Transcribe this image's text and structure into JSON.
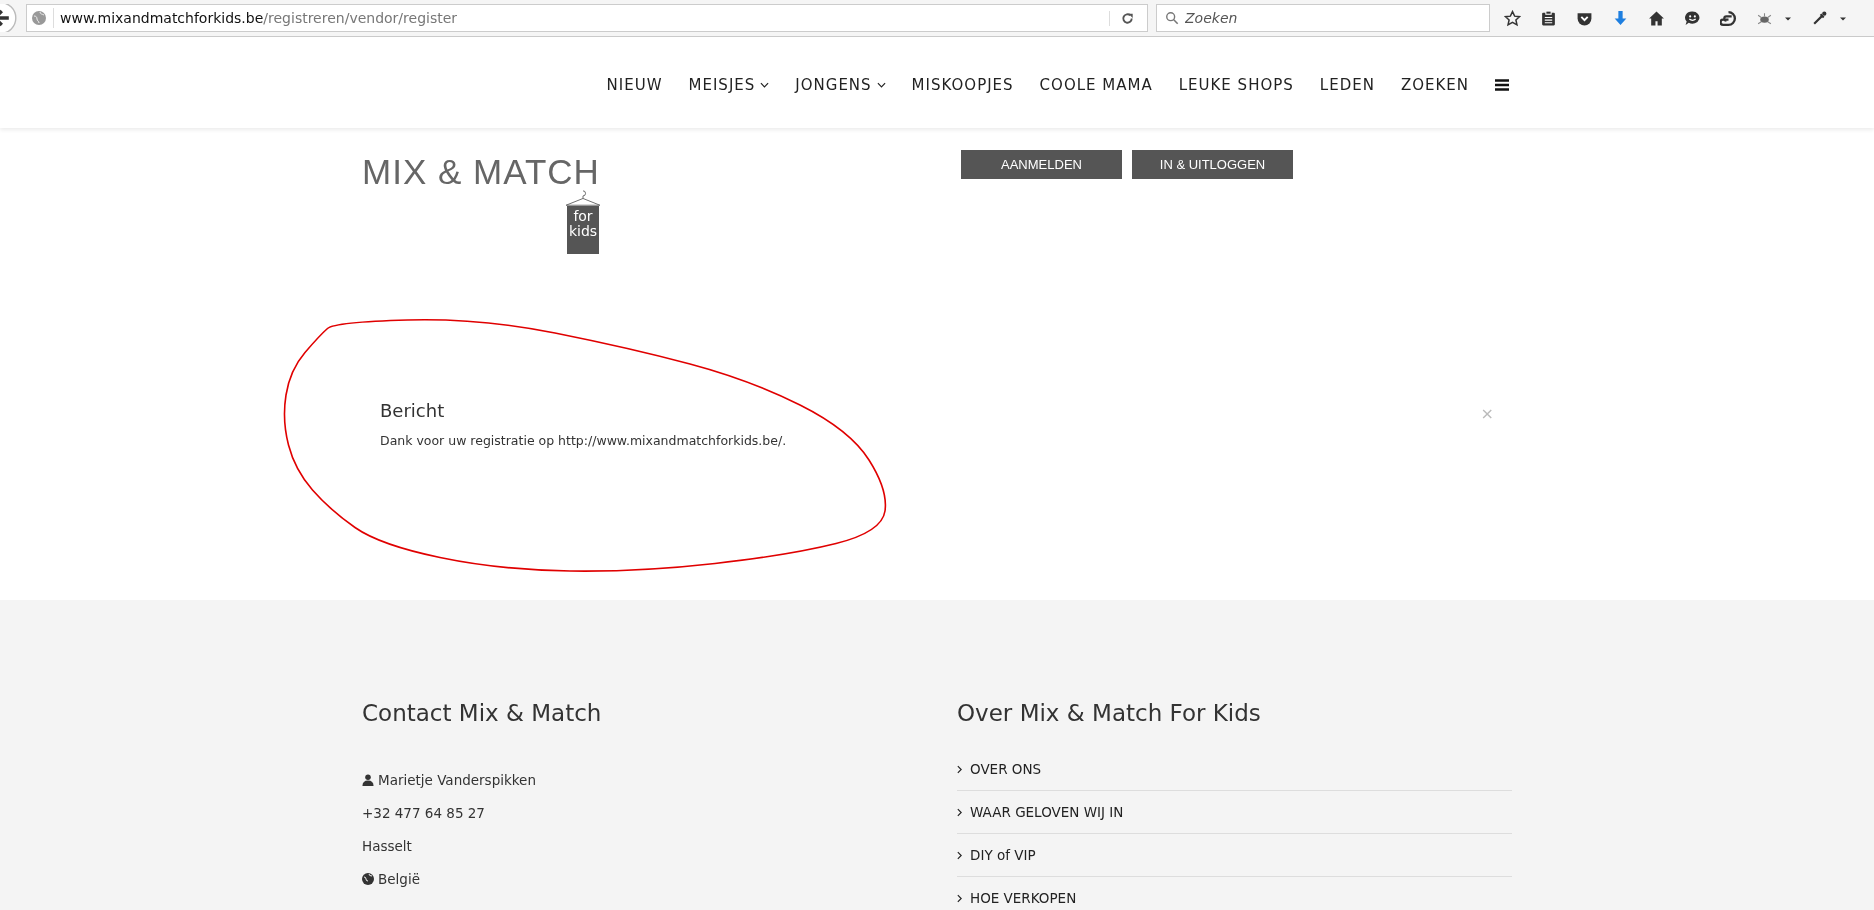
{
  "browser": {
    "url_host": "www.mixandmatchforkids.be",
    "url_path": "/registreren/vendor/register",
    "search_placeholder": "Zoeken"
  },
  "nav": {
    "items": [
      {
        "label": "NIEUW",
        "dropdown": false
      },
      {
        "label": "MEISJES",
        "dropdown": true
      },
      {
        "label": "JONGENS",
        "dropdown": true
      },
      {
        "label": "MISKOOPJES",
        "dropdown": false
      },
      {
        "label": "COOLE MAMA",
        "dropdown": false
      },
      {
        "label": "LEUKE SHOPS",
        "dropdown": false
      },
      {
        "label": "LEDEN",
        "dropdown": false
      },
      {
        "label": "ZOEKEN",
        "dropdown": false
      }
    ]
  },
  "logo": {
    "title": "MIX & MATCH",
    "tag_top": "for",
    "tag_bottom": "kids"
  },
  "auth_buttons": [
    "AANMELDEN",
    "IN & UITLOGGEN"
  ],
  "message": {
    "title": "Bericht",
    "text": "Dank voor uw registratie op http://www.mixandmatchforkids.be/.",
    "close": "×"
  },
  "footer": {
    "contact": {
      "title": "Contact Mix & Match",
      "items": [
        {
          "kind": "person",
          "text": "Marietje Vanderspikken"
        },
        {
          "kind": "plain",
          "text": "+32 477 64 85 27"
        },
        {
          "kind": "plain",
          "text": "Hasselt"
        },
        {
          "kind": "globe",
          "text": "België"
        }
      ]
    },
    "about": {
      "title": "Over Mix & Match For Kids",
      "links": [
        "OVER ONS",
        "WAAR GELOVEN WIJ IN",
        "DIY of VIP",
        "HOE VERKOPEN"
      ]
    }
  }
}
